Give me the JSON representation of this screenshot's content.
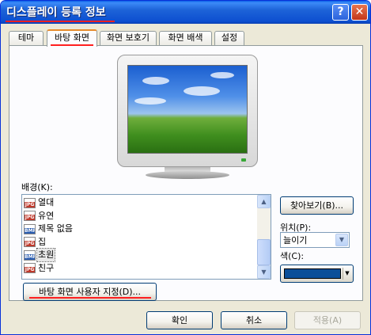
{
  "window": {
    "title": "디스플레이 등록 정보",
    "help_icon_glyph": "?",
    "close_icon_glyph": "✕"
  },
  "tabs": [
    {
      "label": "테마",
      "active": false
    },
    {
      "label": "바탕 화면",
      "active": true
    },
    {
      "label": "화면 보호기",
      "active": false
    },
    {
      "label": "화면 배색",
      "active": false
    },
    {
      "label": "설정",
      "active": false
    }
  ],
  "background": {
    "label": "배경(K):",
    "items": [
      {
        "label": "열대",
        "icon": "jpg-file-icon",
        "icon_tag": "JPG",
        "icon_color": "#c0392b",
        "selected": false
      },
      {
        "label": "유연",
        "icon": "jpg-file-icon",
        "icon_tag": "JPG",
        "icon_color": "#c0392b",
        "selected": false
      },
      {
        "label": "제목 없음",
        "icon": "bmp-file-icon",
        "icon_tag": "BMP",
        "icon_color": "#2a5db0",
        "selected": false
      },
      {
        "label": "집",
        "icon": "jpg-file-icon",
        "icon_tag": "JPG",
        "icon_color": "#c0392b",
        "selected": false
      },
      {
        "label": "초원",
        "icon": "bmp-file-icon",
        "icon_tag": "BMP",
        "icon_color": "#2a5db0",
        "selected": true
      },
      {
        "label": "친구",
        "icon": "jpg-file-icon",
        "icon_tag": "JPG",
        "icon_color": "#c0392b",
        "selected": false
      }
    ]
  },
  "browse_button": "찾아보기(B)...",
  "position": {
    "label": "위치(P):",
    "value": "늘이기"
  },
  "color": {
    "label": "색(C):",
    "value": "#0b4f99"
  },
  "customize_button": "바탕 화면 사용자 지정(D)...",
  "footer": {
    "ok": "확인",
    "cancel": "취소",
    "apply": "적용(A)"
  },
  "colors": {
    "titlebar": "#0a5ee8",
    "dialog_bg": "#ece9d8",
    "annotation_red": "#ff2020"
  }
}
